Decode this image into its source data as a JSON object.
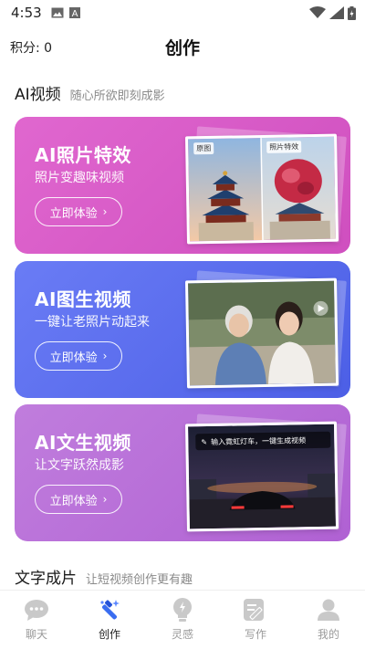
{
  "status_bar": {
    "time": "4:53"
  },
  "header": {
    "points_label": "积分: 0",
    "title": "创作"
  },
  "sections": {
    "ai_video": {
      "title": "AI视频",
      "subtitle": "随心所欲即刻成影"
    },
    "text_film": {
      "title": "文字成片",
      "subtitle": "让短视频创作更有趣"
    }
  },
  "cards": [
    {
      "title": "AI照片特效",
      "subtitle": "照片变趣味视频",
      "button": "立即体验",
      "tags": [
        "原图",
        "照片特效"
      ],
      "color": "#d659c4"
    },
    {
      "title": "AI图生视频",
      "subtitle": "一键让老照片动起来",
      "button": "立即体验",
      "color": "#5b6ef0"
    },
    {
      "title": "AI文生视频",
      "subtitle": "让文字跃然成影",
      "button": "立即体验",
      "prompt": "输入霓虹灯车，一键生成视频",
      "color": "#b96fd8"
    }
  ],
  "nav": [
    {
      "label": "聊天",
      "icon": "chat-icon"
    },
    {
      "label": "创作",
      "icon": "magic-wand-icon",
      "active": true
    },
    {
      "label": "灵感",
      "icon": "bulb-icon"
    },
    {
      "label": "写作",
      "icon": "write-icon"
    },
    {
      "label": "我的",
      "icon": "person-icon"
    }
  ]
}
